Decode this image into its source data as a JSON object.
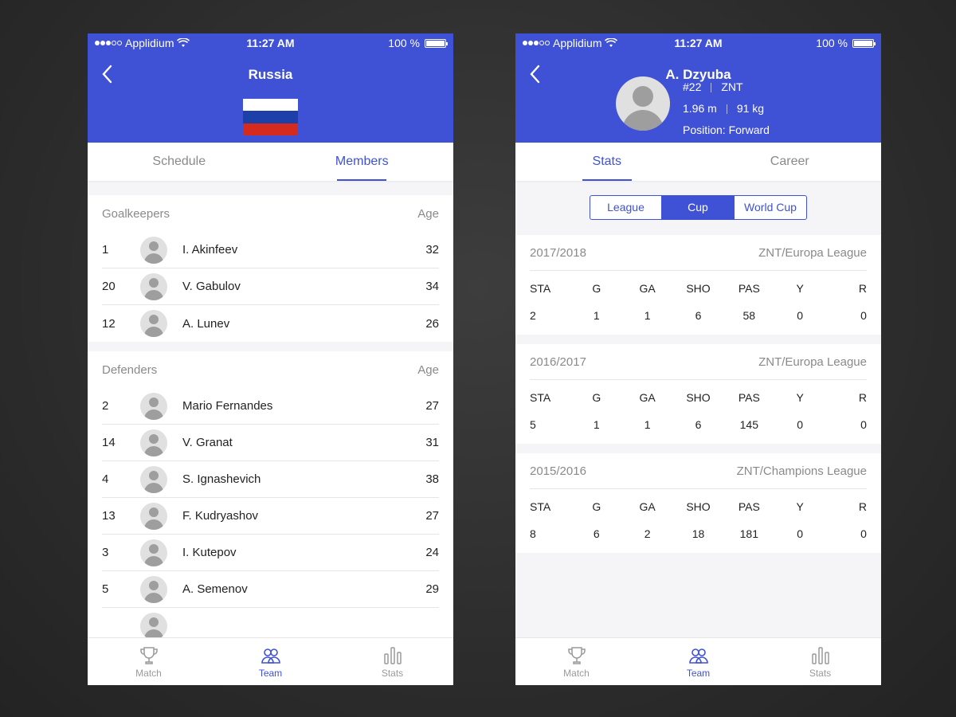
{
  "status": {
    "carrier": "Applidium",
    "time": "11:27 AM",
    "battery": "100 %"
  },
  "team": {
    "title": "Russia",
    "tabs": [
      "Schedule",
      "Members"
    ],
    "sections": [
      {
        "title": "Goalkeepers",
        "age_label": "Age",
        "players": [
          {
            "num": "1",
            "name": "I. Akinfeev",
            "age": "32"
          },
          {
            "num": "20",
            "name": "V. Gabulov",
            "age": "34"
          },
          {
            "num": "12",
            "name": "A. Lunev",
            "age": "26"
          }
        ]
      },
      {
        "title": "Defenders",
        "age_label": "Age",
        "players": [
          {
            "num": "2",
            "name": "Mario Fernandes",
            "age": "27"
          },
          {
            "num": "14",
            "name": "V. Granat",
            "age": "31"
          },
          {
            "num": "4",
            "name": "S. Ignashevich",
            "age": "38"
          },
          {
            "num": "13",
            "name": "F. Kudryashov",
            "age": "27"
          },
          {
            "num": "3",
            "name": "I. Kutepov",
            "age": "24"
          },
          {
            "num": "5",
            "name": "A. Semenov",
            "age": "29"
          }
        ]
      }
    ]
  },
  "player": {
    "name": "A. Dzyuba",
    "number": "#22",
    "team": "ZNT",
    "height": "1.96 m",
    "weight": "91 kg",
    "position": "Position: Forward",
    "tabs": [
      "Stats",
      "Career"
    ],
    "segments": [
      "League",
      "Cup",
      "World Cup"
    ],
    "columns": [
      "STA",
      "G",
      "GA",
      "SHO",
      "PAS",
      "Y",
      "R"
    ],
    "seasons": [
      {
        "season": "2017/2018",
        "competition": "ZNT/Europa League",
        "values": [
          "2",
          "1",
          "1",
          "6",
          "58",
          "0",
          "0"
        ]
      },
      {
        "season": "2016/2017",
        "competition": "ZNT/Europa League",
        "values": [
          "5",
          "1",
          "1",
          "6",
          "145",
          "0",
          "0"
        ]
      },
      {
        "season": "2015/2016",
        "competition": "ZNT/Champions League",
        "values": [
          "8",
          "6",
          "2",
          "18",
          "181",
          "0",
          "0"
        ]
      }
    ]
  },
  "tabbar": [
    {
      "label": "Match",
      "icon": "trophy-icon"
    },
    {
      "label": "Team",
      "icon": "team-icon"
    },
    {
      "label": "Stats",
      "icon": "stats-icon"
    }
  ],
  "colors": {
    "primary": "#3f51d4",
    "flag": [
      "#ffffff",
      "#1c3fa8",
      "#d52b1e"
    ]
  }
}
